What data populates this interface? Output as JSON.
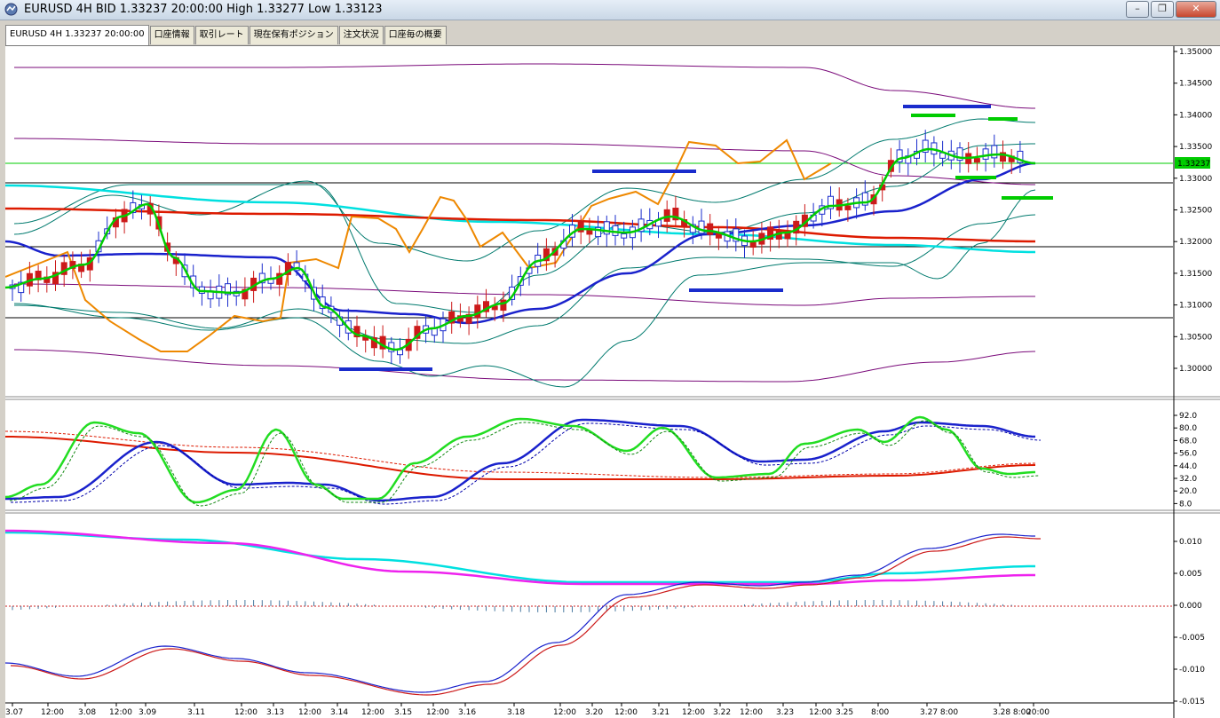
{
  "window": {
    "title": "EURUSD 4H BID 1.33237 20:00:00 High 1.33277 Low 1.33123",
    "minimize": "–",
    "restore": "❐",
    "close": "✕"
  },
  "tabs": [
    {
      "label": "EURUSD 4H 1.33237 20:00:00",
      "active": true
    },
    {
      "label": "口座情報"
    },
    {
      "label": "取引レート"
    },
    {
      "label": "現在保有ポジション"
    },
    {
      "label": "注文状況"
    },
    {
      "label": "口座毎の概要"
    }
  ],
  "main_pane": {
    "price_ticks": [
      "1.35000",
      "1.34500",
      "1.34000",
      "1.33500",
      "1.33000",
      "1.32500",
      "1.32000",
      "1.31500",
      "1.31000",
      "1.30500",
      "1.30000"
    ],
    "current_price": "1.33237"
  },
  "osc_pane": {
    "ticks": [
      "92.0",
      "80.0",
      "68.0",
      "56.0",
      "44.0",
      "32.0",
      "20.0",
      "8.0"
    ]
  },
  "macd_pane": {
    "ticks": [
      "0.010",
      "0.005",
      "0.000",
      "-0.005",
      "-0.010",
      "-0.015"
    ]
  },
  "x_labels": [
    "3.07",
    "12:00",
    "3.08",
    "12:00",
    "3.09",
    "3.11",
    "12:00",
    "3.13",
    "12:00",
    "3.14",
    "12:00",
    "3.15",
    "12:00",
    "3.16",
    "3.18",
    "12:00",
    "3.20",
    "12:00",
    "3.21",
    "12:00",
    "3.22",
    "12:00",
    "3.23",
    "12:00",
    "3.25",
    "8:00",
    "3.27 8:00",
    "3.28 8:00",
    "20:00"
  ],
  "colors": {
    "bull": "#1a2ccc",
    "bear": "#cc1a1a",
    "ma_fast": "#00cc00",
    "ma_mid": "#1a22cc",
    "ma_slow": "#dd1a00",
    "ma_long": "#00e0e0",
    "envelope": "#7a0a7a",
    "boll": "#007a6e",
    "orange": "#ee8800",
    "level": "#00cc00"
  }
}
